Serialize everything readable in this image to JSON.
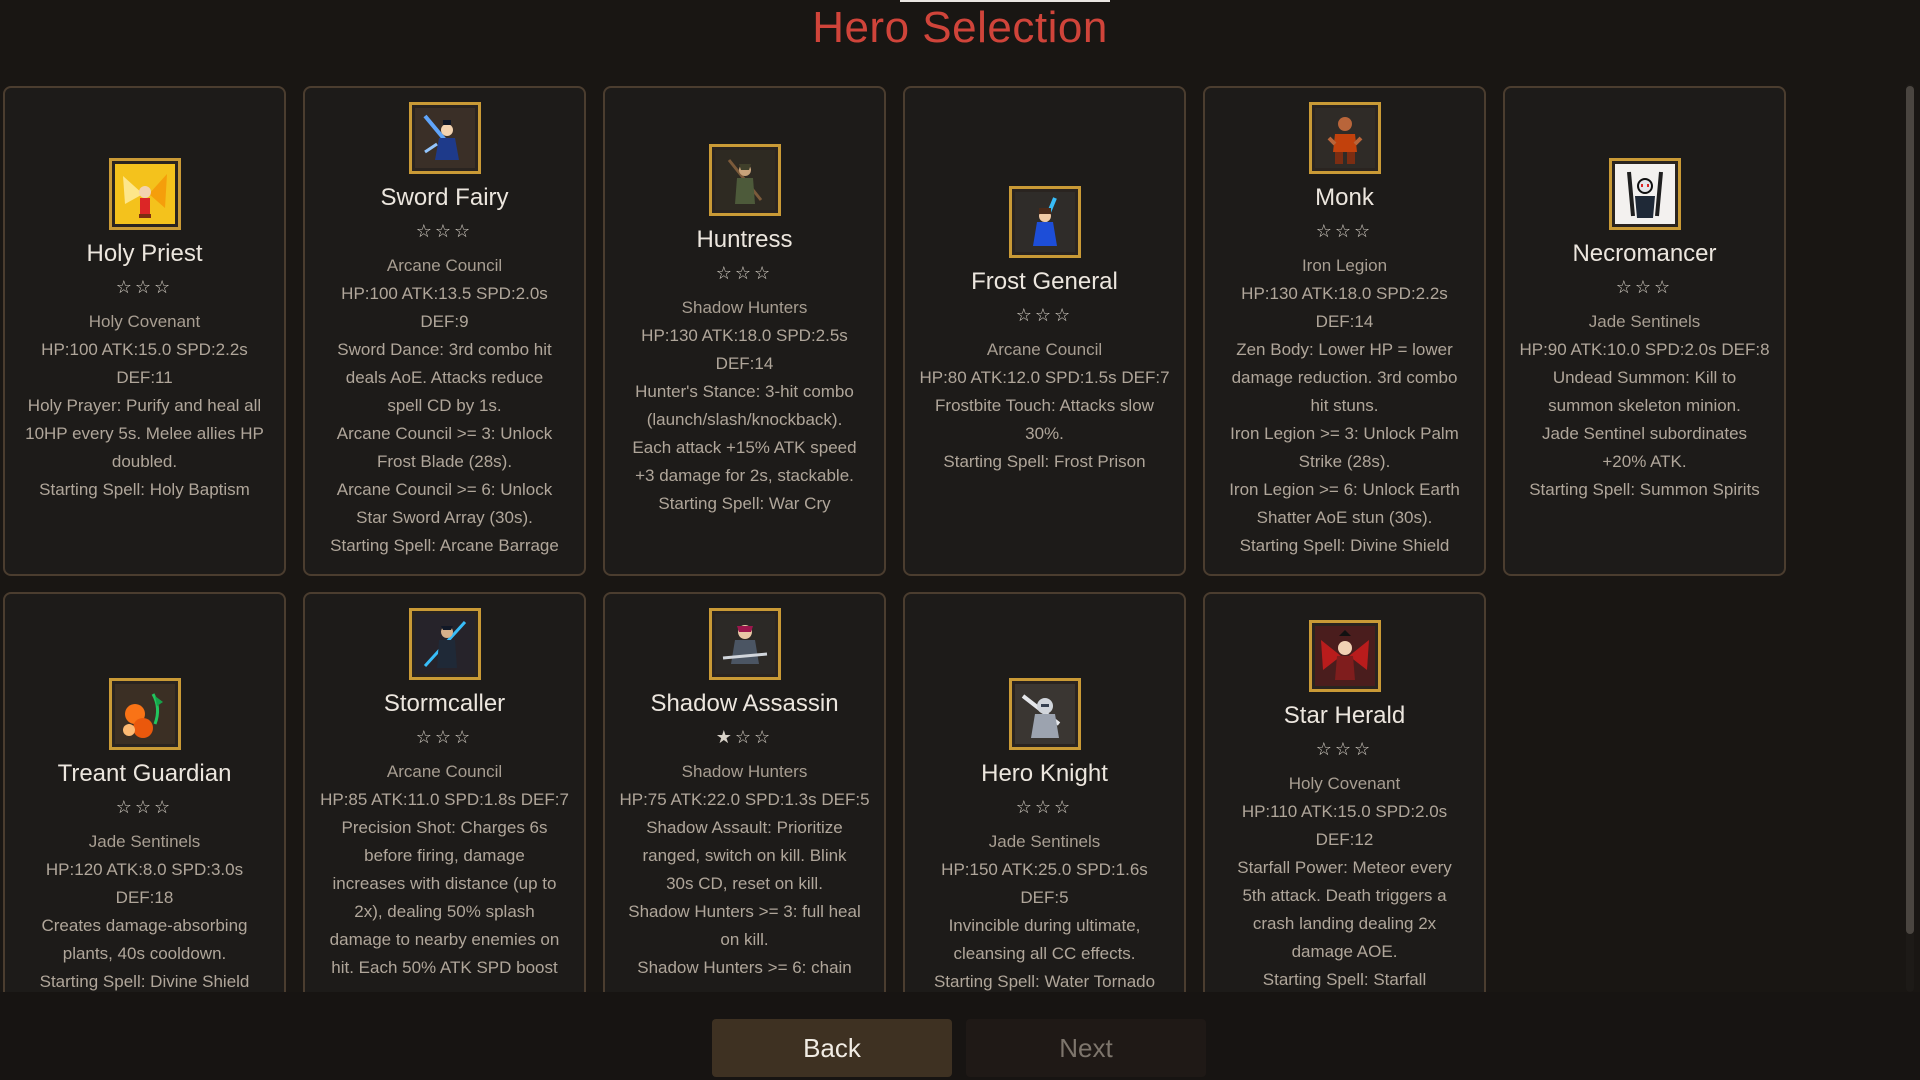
{
  "title": "Hero Selection",
  "colors": {
    "title": "#d0443a",
    "frame": "#c99a36",
    "card_border": "#4b3d2f",
    "back_button": "#3e3122"
  },
  "buttons": {
    "back": "Back",
    "next": "Next"
  },
  "heroes": [
    {
      "name": "Holy Priest",
      "stars": "☆☆☆",
      "faction": "Holy Covenant",
      "desc": [
        "HP:100 ATK:15.0 SPD:2.2s",
        "DEF:11",
        "Holy Prayer: Purify and heal all",
        "10HP every 5s. Melee allies HP",
        "doubled."
      ],
      "spell": "Starting Spell:  Holy Baptism",
      "icon": "holy-priest-portrait-icon"
    },
    {
      "name": "Sword Fairy",
      "stars": "☆☆☆",
      "faction": "Arcane Council",
      "desc": [
        "HP:100 ATK:13.5 SPD:2.0s DEF:9",
        "Sword Dance: 3rd combo hit",
        "deals AoE. Attacks reduce",
        "spell CD by 1s.",
        "Arcane Council >= 3: Unlock",
        "Frost Blade (28s).",
        "Arcane Council >= 6: Unlock",
        "Star Sword Array (30s)."
      ],
      "spell": "Starting Spell:  Arcane Barrage",
      "icon": "sword-fairy-portrait-icon"
    },
    {
      "name": "Huntress",
      "stars": "☆☆☆",
      "faction": "Shadow Hunters",
      "desc": [
        "HP:130 ATK:18.0 SPD:2.5s",
        "DEF:14",
        "Hunter's Stance: 3-hit combo",
        "(launch/slash/knockback).",
        "Each attack +15% ATK speed",
        "+3 damage for 2s, stackable."
      ],
      "spell": "Starting Spell:  War Cry",
      "icon": "huntress-portrait-icon"
    },
    {
      "name": "Frost General",
      "stars": "☆☆☆",
      "faction": "Arcane Council",
      "desc": [
        "HP:80 ATK:12.0 SPD:1.5s DEF:7",
        "Frostbite Touch: Attacks slow",
        "30%."
      ],
      "spell": "Starting Spell:  Frost Prison",
      "icon": "frost-general-portrait-icon"
    },
    {
      "name": "Monk",
      "stars": "☆☆☆",
      "faction": "Iron Legion",
      "desc": [
        "HP:130 ATK:18.0 SPD:2.2s",
        "DEF:14",
        "Zen Body: Lower HP = lower",
        "damage reduction. 3rd combo",
        "hit stuns.",
        "Iron Legion >= 3: Unlock Palm",
        "Strike (28s).",
        "Iron Legion >= 6: Unlock Earth",
        "Shatter AoE stun (30s)."
      ],
      "spell": "Starting Spell:  Divine Shield",
      "icon": "monk-portrait-icon"
    },
    {
      "name": "Necromancer",
      "stars": "☆☆☆",
      "faction": "Jade Sentinels",
      "desc": [
        "HP:90 ATK:10.0 SPD:2.0s DEF:8",
        "Undead Summon: Kill to",
        "summon skeleton minion.",
        "Jade Sentinel subordinates",
        "+20% ATK."
      ],
      "spell": "Starting Spell:  Summon Spirits",
      "icon": "necromancer-portrait-icon"
    },
    {
      "name": "Treant Guardian",
      "stars": "☆☆☆",
      "faction": "Jade Sentinels",
      "desc": [
        "HP:120 ATK:8.0 SPD:3.0s DEF:18",
        "Creates damage-absorbing",
        "plants, 40s cooldown."
      ],
      "spell": "Starting Spell:  Divine Shield",
      "icon": "treant-guardian-portrait-icon"
    },
    {
      "name": "Stormcaller",
      "stars": "☆☆☆",
      "faction": "Arcane Council",
      "desc": [
        "HP:85 ATK:11.0 SPD:1.8s DEF:7",
        "Precision Shot: Charges 6s",
        "before firing, damage",
        "increases with distance (up to",
        "2x), dealing 50% splash",
        "damage to nearby enemies on",
        "hit. Each 50% ATK SPD boost"
      ],
      "spell": "",
      "icon": "stormcaller-portrait-icon"
    },
    {
      "name": "Shadow Assassin",
      "stars": "★☆☆",
      "faction": "Shadow Hunters",
      "desc": [
        "HP:75 ATK:22.0 SPD:1.3s DEF:5",
        "Shadow Assault: Prioritize",
        "ranged, switch on kill. Blink",
        "30s CD, reset on kill.",
        "Shadow Hunters >= 3: full heal",
        "on kill.",
        "Shadow Hunters >= 6: chain"
      ],
      "spell": "",
      "icon": "shadow-assassin-portrait-icon"
    },
    {
      "name": "Hero Knight",
      "stars": "☆☆☆",
      "faction": "Jade Sentinels",
      "desc": [
        "HP:150 ATK:25.0 SPD:1.6s DEF:5",
        "Invincible during ultimate,",
        "cleansing all CC effects."
      ],
      "spell": "Starting Spell:  Water Tornado",
      "icon": "hero-knight-portrait-icon"
    },
    {
      "name": "Star Herald",
      "stars": "☆☆☆",
      "faction": "Holy Covenant",
      "desc": [
        "HP:110 ATK:15.0 SPD:2.0s",
        "DEF:12",
        "Starfall Power: Meteor every",
        "5th attack. Death triggers a",
        "crash landing dealing 2x",
        "damage AOE."
      ],
      "spell": "Starting Spell:  Starfall",
      "icon": "star-herald-portrait-icon"
    }
  ]
}
